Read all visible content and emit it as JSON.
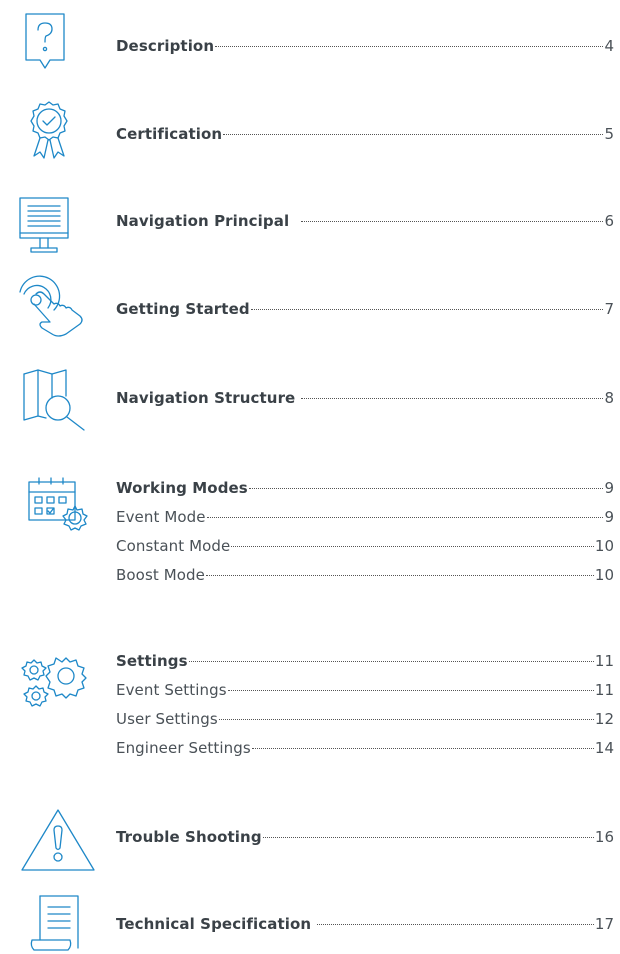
{
  "toc": [
    {
      "icon": "question-bubble-icon",
      "title": "Description",
      "page": "4"
    },
    {
      "icon": "certification-award-icon",
      "title": "Certification",
      "page": "5"
    },
    {
      "icon": "monitor-icon",
      "title": "Navigation Principal",
      "page": "6"
    },
    {
      "icon": "touch-hand-icon",
      "title": "Getting Started",
      "page": "7"
    },
    {
      "icon": "map-search-icon",
      "title": "Navigation Structure",
      "page": "8"
    },
    {
      "icon": "calendar-gear-icon",
      "title": "Working Modes",
      "page": "9",
      "sub": [
        {
          "title": "Event Mode",
          "page": "9"
        },
        {
          "title": "Constant Mode",
          "page": "10"
        },
        {
          "title": "Boost Mode",
          "page": "10"
        }
      ]
    },
    {
      "icon": "gears-icon",
      "title": "Settings",
      "page": "11",
      "sub": [
        {
          "title": "Event Settings",
          "page": "11"
        },
        {
          "title": "User Settings",
          "page": "12"
        },
        {
          "title": "Engineer Settings",
          "page": "14"
        }
      ]
    },
    {
      "icon": "warning-triangle-icon",
      "title": "Trouble Shooting",
      "page": "16"
    },
    {
      "icon": "document-scroll-icon",
      "title": "Technical Specification",
      "page": "17"
    }
  ],
  "colors": {
    "icon": "#1e88c8",
    "text": "#3a4147"
  }
}
